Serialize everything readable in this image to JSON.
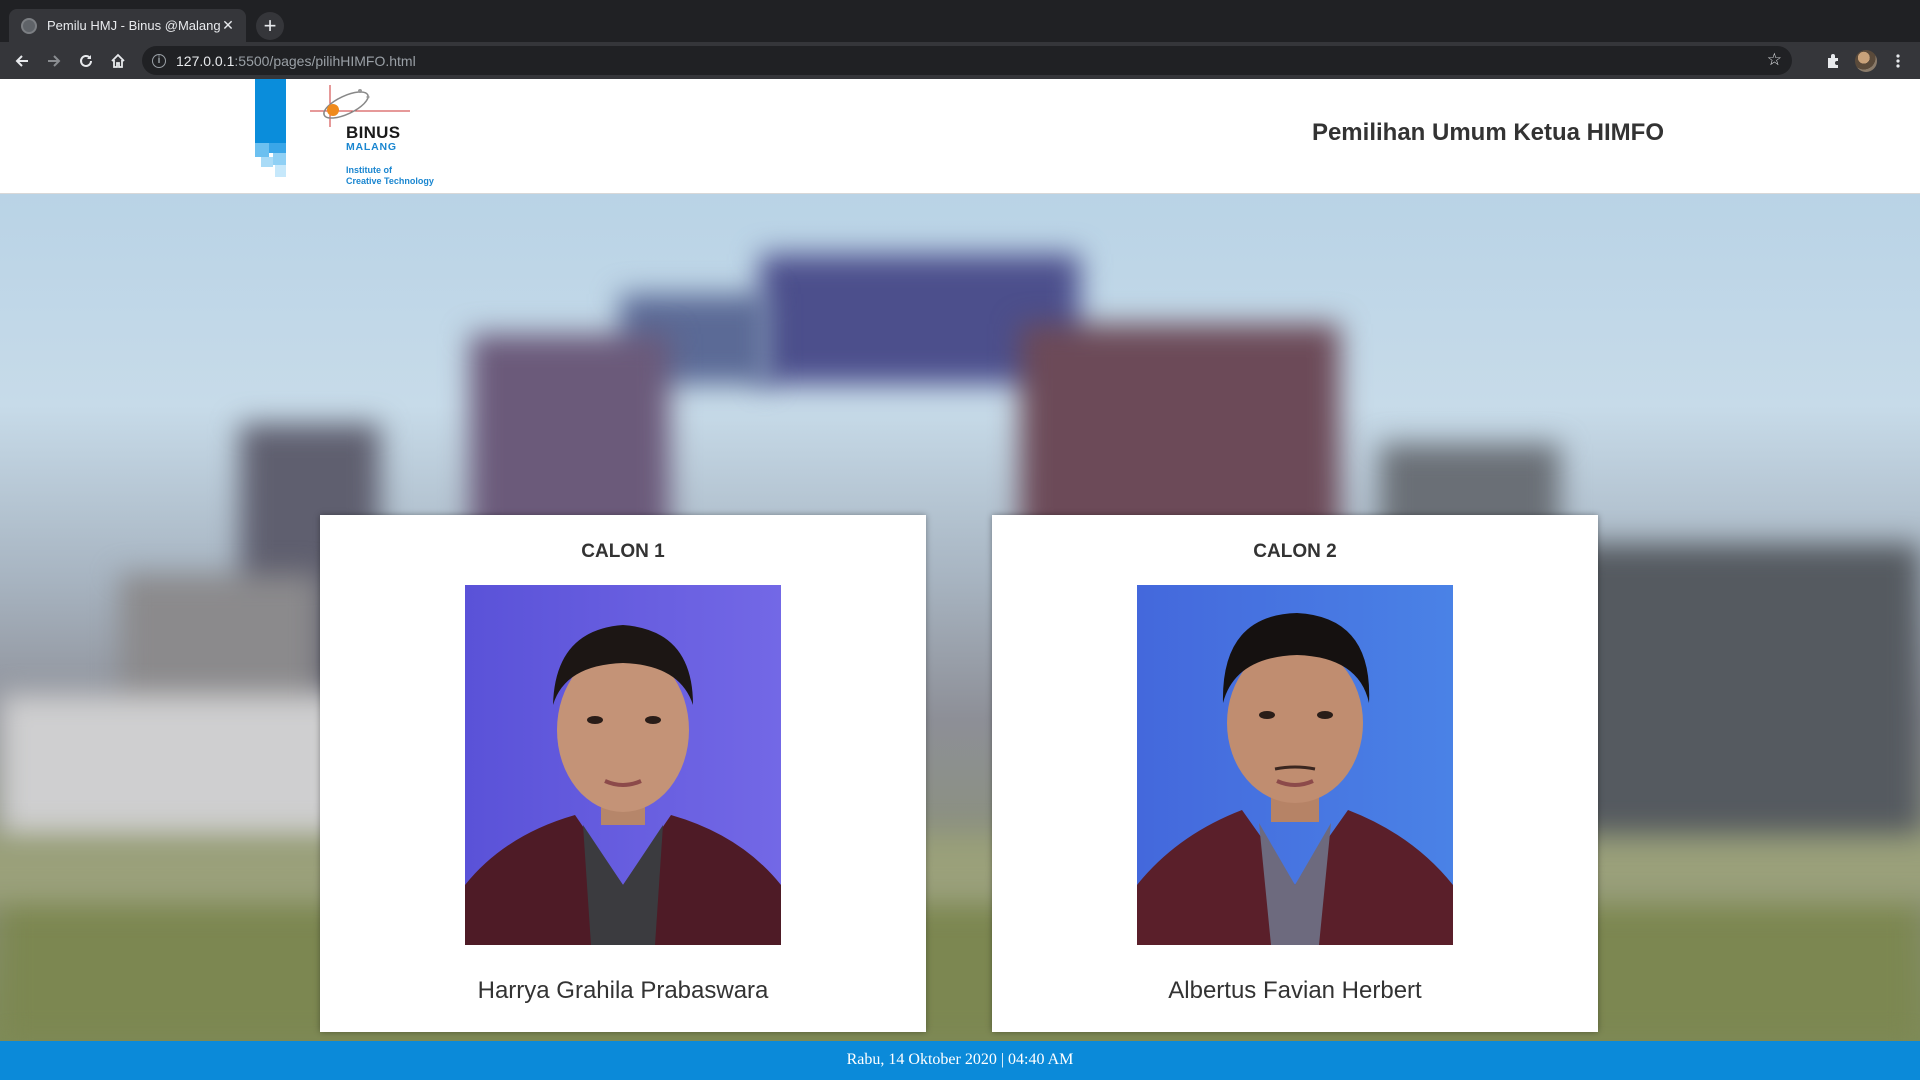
{
  "browser": {
    "tab_title": "Pemilu HMJ - Binus @Malang",
    "tab_close_icon": "close-icon",
    "url_host": "127.0.0.1",
    "url_rest": ":5500/pages/pilihHIMFO.html"
  },
  "header": {
    "logo_word": "BINUS",
    "logo_sub": "MALANG",
    "logo_tagline_1": "Institute of",
    "logo_tagline_2": "Creative Technology",
    "title": "Pemilihan Umum Ketua HIMFO"
  },
  "candidates": [
    {
      "label": "CALON 1",
      "name": "Harrya Grahila Prabaswara"
    },
    {
      "label": "CALON 2",
      "name": "Albertus Favian Herbert"
    }
  ],
  "footer": {
    "datetime": "Rabu, 14 Oktober 2020 | 04:40 AM"
  },
  "colors": {
    "brand_blue": "#0b8ad9",
    "chrome_dark": "#202124",
    "photo_bg_1": "#6a5fe0",
    "photo_bg_2": "#4a78e2",
    "jacket": "#5a1f2a"
  }
}
